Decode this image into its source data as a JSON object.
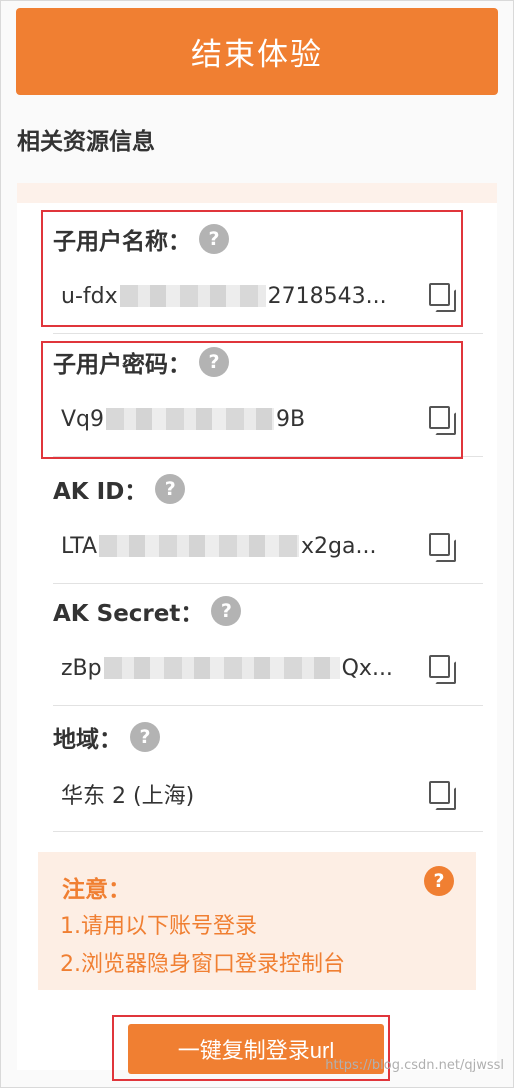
{
  "end_button": "结束体验",
  "section_title": "相关资源信息",
  "fields": [
    {
      "label": "子用户名称：",
      "value_prefix": "u-fdx",
      "value_suffix": "2718543..."
    },
    {
      "label": "子用户密码：",
      "value_prefix": "Vq9",
      "value_suffix": "9B"
    },
    {
      "label": "AK ID：",
      "value_prefix": "LTA",
      "value_suffix": "x2ga..."
    },
    {
      "label": "AK Secret：",
      "value_prefix": "zBp",
      "value_suffix": "Qx..."
    },
    {
      "label": "地域：",
      "value_prefix": "华东 2 (上海)",
      "value_suffix": ""
    }
  ],
  "help_glyph": "?",
  "notice": {
    "title": "注意：",
    "line1": "1.请用以下账号登录",
    "line2": "2.浏览器隐身窗口登录控制台",
    "help_glyph": "?"
  },
  "copy_url_button": "一键复制登录url",
  "watermark": "https://blog.csdn.net/qjwssl",
  "colors": {
    "accent": "#f07f32",
    "highlight": "#e0353b",
    "notice_bg": "#fdeee4"
  }
}
